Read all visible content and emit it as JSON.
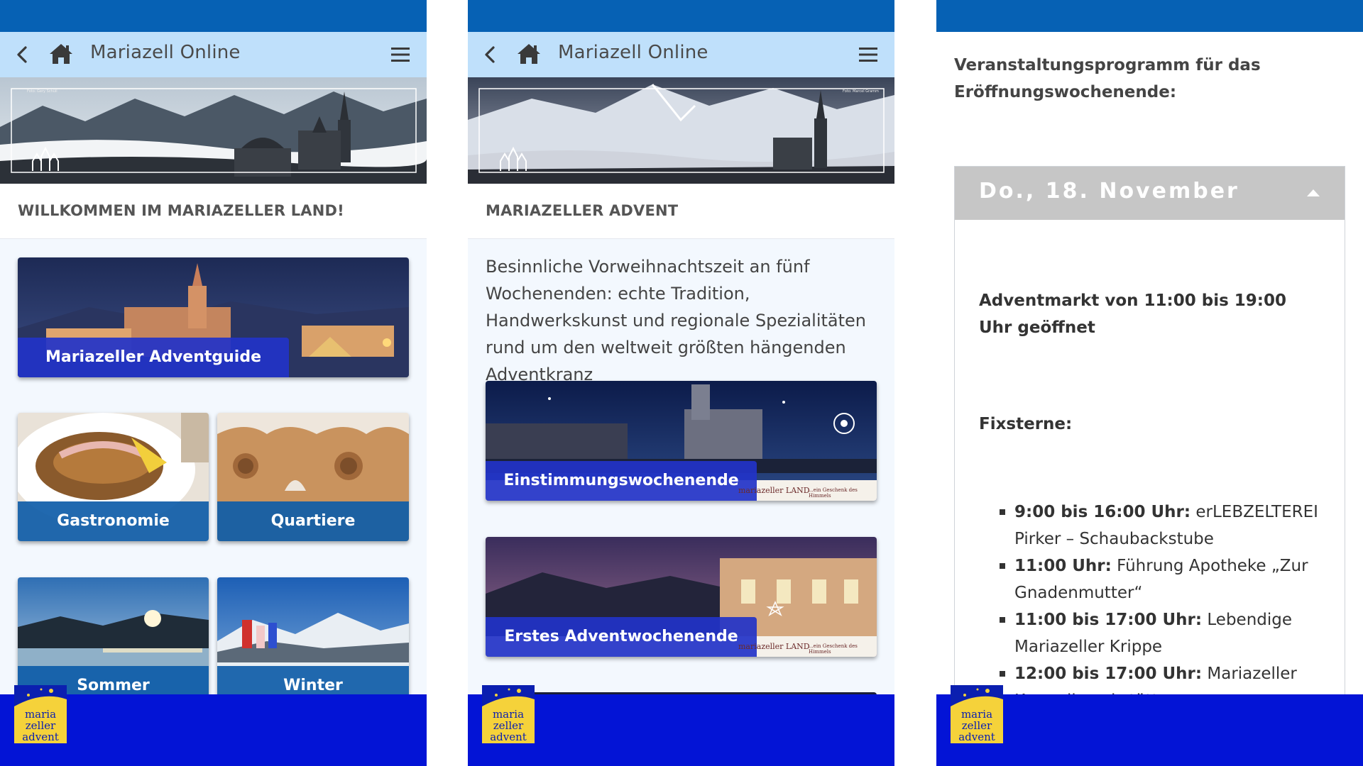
{
  "colors": {
    "status_bar": "#0661b4",
    "header": "#bfe0fb",
    "footer": "#0314d6",
    "tile_label_blue": "#0e5ca8",
    "tile_label_royal": "#2233c8",
    "accordion_header": "#c6c6c6"
  },
  "icons": {
    "back": "chevron-left-icon",
    "home": "home-icon",
    "menu": "hamburger-menu-icon",
    "footer_logo": "mariazeller-advent-logo",
    "accordion_toggle": "caret-up-icon"
  },
  "app": {
    "title": "Mariazell Online",
    "footer_logo_text": [
      "maria",
      "zeller",
      "advent"
    ]
  },
  "screen1": {
    "hero_credit": "Foto: Gery Schüll",
    "section_title": "WILLKOMMEN IM MARIAZELLER LAND!",
    "feature_tile": {
      "label": "Mariazeller Adventguide"
    },
    "grid_tiles": [
      {
        "label": "Gastronomie"
      },
      {
        "label": "Quartiere"
      },
      {
        "label": "Sommer"
      },
      {
        "label": "Winter"
      }
    ]
  },
  "screen2": {
    "hero_credit": "Foto: Marcel Gramm",
    "section_title": "MARIAZELLER ADVENT",
    "intro": "Besinnliche Vorweihnachtszeit an fünf Wochenenden: echte Tradition, Handwerkskunst und regionale Spezialitäten rund um den weltweit größten hängenden Adventkranz",
    "banner_brand": "mariazeller LAND",
    "banner_tagline": "...ein Geschenk des Himmels",
    "cards": [
      {
        "label": "Einstimmungswochenende"
      },
      {
        "label": "Erstes Adventwochenende"
      }
    ]
  },
  "screen3": {
    "heading": "Veranstaltungsprogramm für das Eröffnungswochenende:",
    "accordion": {
      "title": "Do., 18. November",
      "opening": "Adventmarkt von 11:00 bis 19:00 Uhr geöffnet",
      "fixstars_title": "Fixsterne:",
      "items": [
        {
          "time": "9:00 bis 16:00 Uhr:",
          "text": " erLEBZELTEREI Pirker – Schaubackstube"
        },
        {
          "time": "11:00 Uhr:",
          "text": " Führung Apotheke „Zur Gnadenmutter“"
        },
        {
          "time": "11:00 bis 17:00 Uhr:",
          "text": " Lebendige Mariazeller Krippe"
        },
        {
          "time": "12:00 bis 17:00 Uhr:",
          "text": " Mariazeller Keramikwerkstätte"
        }
      ]
    }
  }
}
